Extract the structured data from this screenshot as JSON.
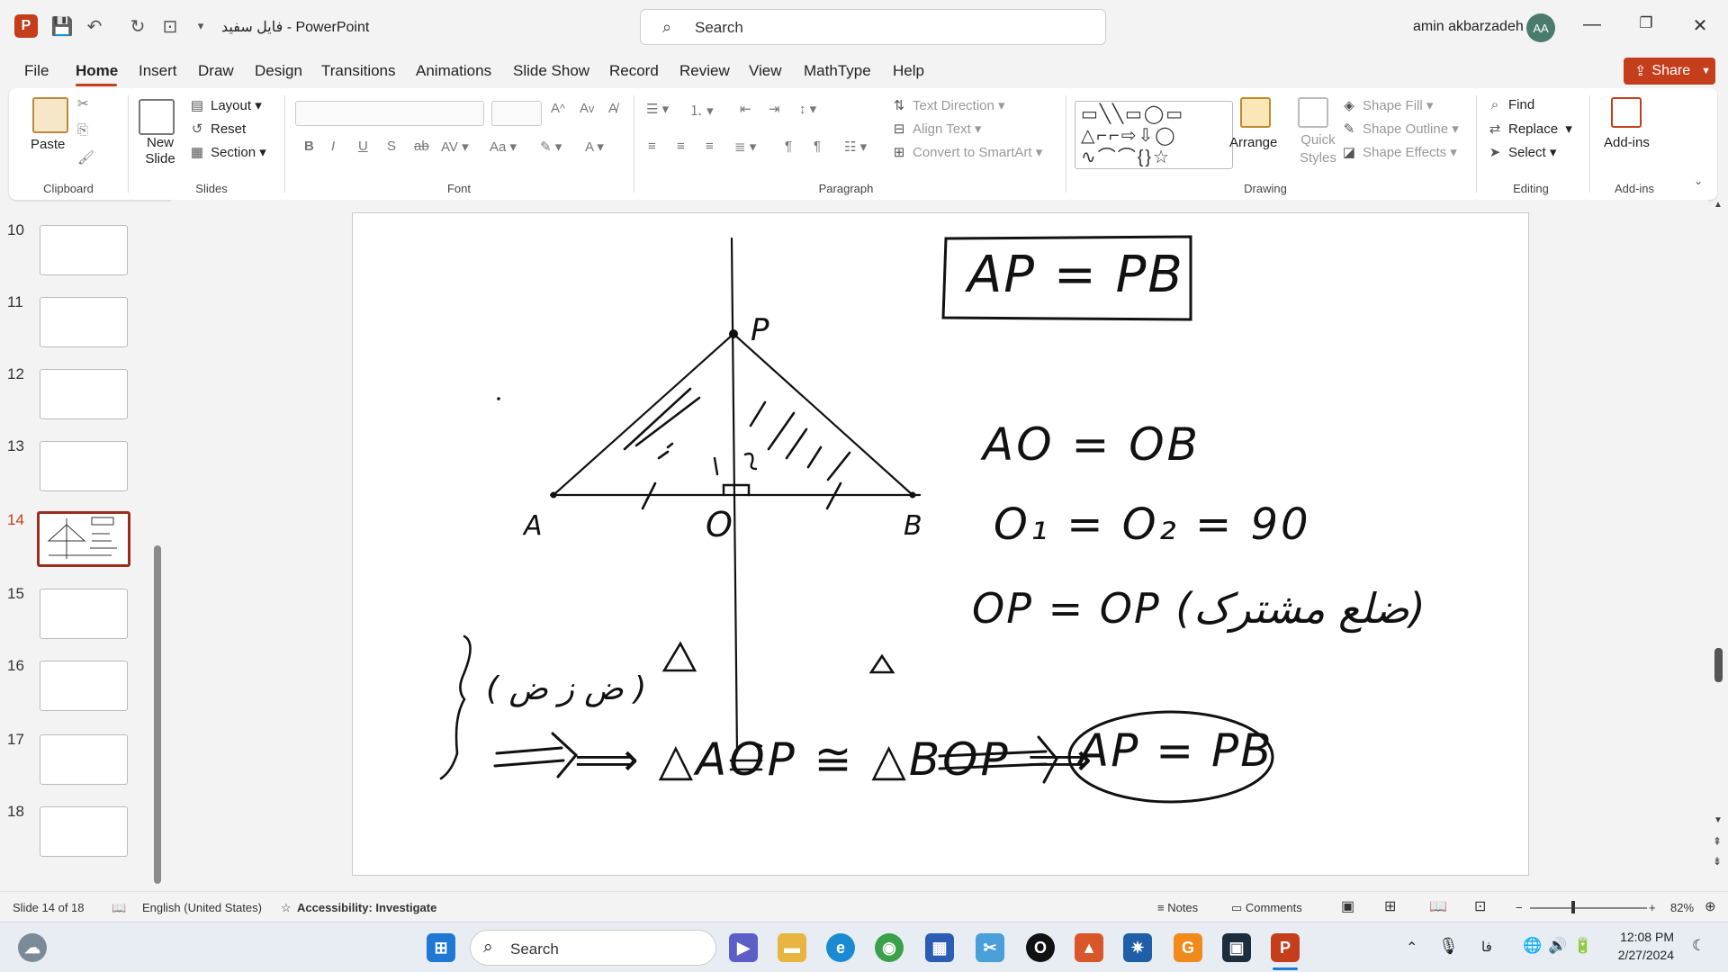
{
  "titlebar": {
    "doc_title": "فایل سفید  -  PowerPoint",
    "search_placeholder": "Search",
    "user_name": "amin akbarzadeh",
    "avatar_initials": "AA"
  },
  "menu": {
    "tabs": [
      "File",
      "Home",
      "Insert",
      "Draw",
      "Design",
      "Transitions",
      "Animations",
      "Slide Show",
      "Record",
      "Review",
      "View",
      "MathType",
      "Help"
    ],
    "active_tab": "Home",
    "share_label": "Share"
  },
  "ribbon": {
    "clipboard": {
      "paste": "Paste",
      "label": "Clipboard"
    },
    "slides": {
      "new_slide": "New Slide",
      "layout": "Layout",
      "reset": "Reset",
      "section": "Section",
      "label": "Slides"
    },
    "font": {
      "label": "Font"
    },
    "paragraph": {
      "text_direction": "Text Direction",
      "align_text": "Align Text",
      "convert_smartart": "Convert to SmartArt",
      "label": "Paragraph"
    },
    "drawing": {
      "arrange": "Arrange",
      "quick_styles": "Quick Styles",
      "shape_fill": "Shape Fill",
      "shape_outline": "Shape Outline",
      "shape_effects": "Shape Effects",
      "label": "Drawing"
    },
    "editing": {
      "find": "Find",
      "replace": "Replace",
      "select": "Select",
      "label": "Editing"
    },
    "addins": {
      "addins": "Add-ins",
      "label": "Add-ins"
    }
  },
  "slides_panel": {
    "numbers": [
      "10",
      "11",
      "12",
      "13",
      "14",
      "15",
      "16",
      "17",
      "18"
    ],
    "selected": "14"
  },
  "slide": {
    "box_top": "AP = PB",
    "label_P": "P",
    "label_A": "A",
    "label_O": "O",
    "label_B": "B",
    "eq1": "AO = OB",
    "eq2": "O₁ = O₂ = 90",
    "eq3": "OP = OP (ضلع مشترک)",
    "note_fz": "( ض ز ض )",
    "conclusion": "⟹  △AOP ≅ △BOP  ⟹",
    "box_bottom": "AP = PB"
  },
  "statusbar": {
    "slide_info": "Slide 14 of 18",
    "language": "English (United States)",
    "accessibility": "Accessibility: Investigate",
    "notes": "Notes",
    "comments": "Comments",
    "zoom": "82%"
  },
  "taskbar": {
    "search_placeholder": "Search",
    "time": "12:08 PM",
    "date": "2/27/2024",
    "lang": "فا"
  }
}
